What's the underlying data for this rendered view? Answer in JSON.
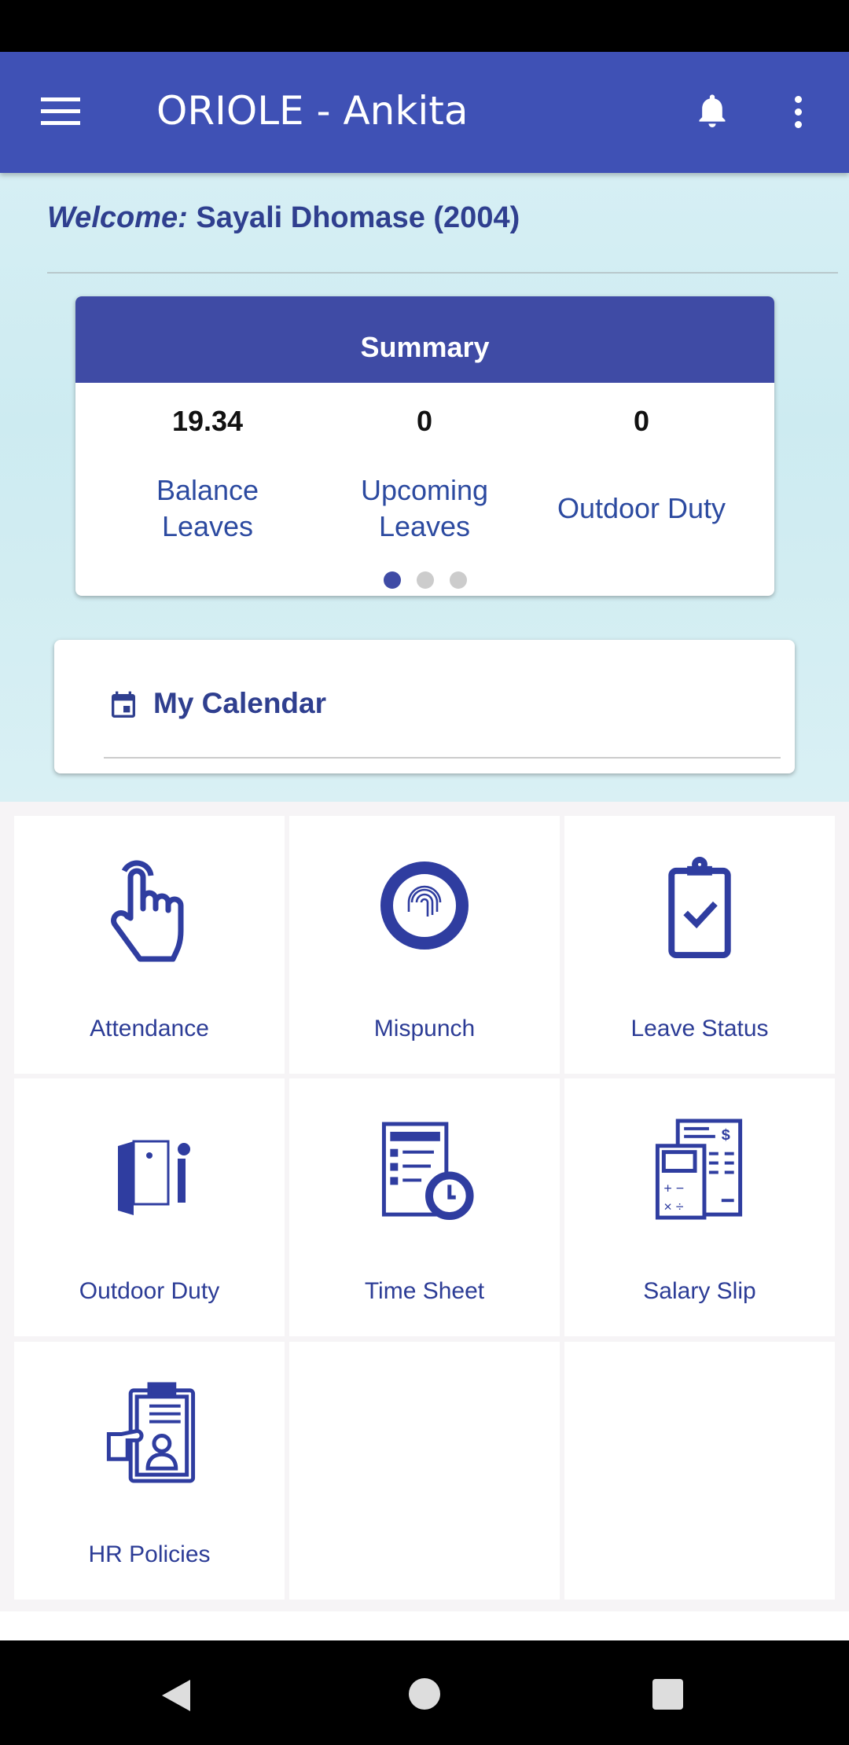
{
  "appbar": {
    "title": "ORIOLE - Ankita",
    "icons": [
      "menu-icon",
      "bell-icon",
      "more-vert-icon"
    ]
  },
  "welcome": {
    "prefix": "Welcome:",
    "name": "Sayali Dhomase (2004)"
  },
  "summary": {
    "title": "Summary",
    "items": [
      {
        "value": "19.34",
        "label": "Balance Leaves"
      },
      {
        "value": "0",
        "label": "Upcoming Leaves"
      },
      {
        "value": "0",
        "label": "Outdoor Duty"
      }
    ],
    "page_count": 3,
    "active_page": 1
  },
  "calendar": {
    "title": "My Calendar"
  },
  "tiles": [
    {
      "label": "Attendance",
      "icon": "tap-hand-icon"
    },
    {
      "label": "Mispunch",
      "icon": "fingerprint-icon"
    },
    {
      "label": "Leave Status",
      "icon": "clipboard-check-icon"
    },
    {
      "label": "Outdoor Duty",
      "icon": "door-exit-icon"
    },
    {
      "label": "Time Sheet",
      "icon": "timesheet-clock-icon"
    },
    {
      "label": "Salary Slip",
      "icon": "calculator-icon"
    },
    {
      "label": "HR Policies",
      "icon": "policy-clipboard-icon"
    }
  ],
  "colors": {
    "primary": "#3f51b5",
    "summary_header": "#3f4ba5",
    "text_accent": "#2c3c96"
  }
}
